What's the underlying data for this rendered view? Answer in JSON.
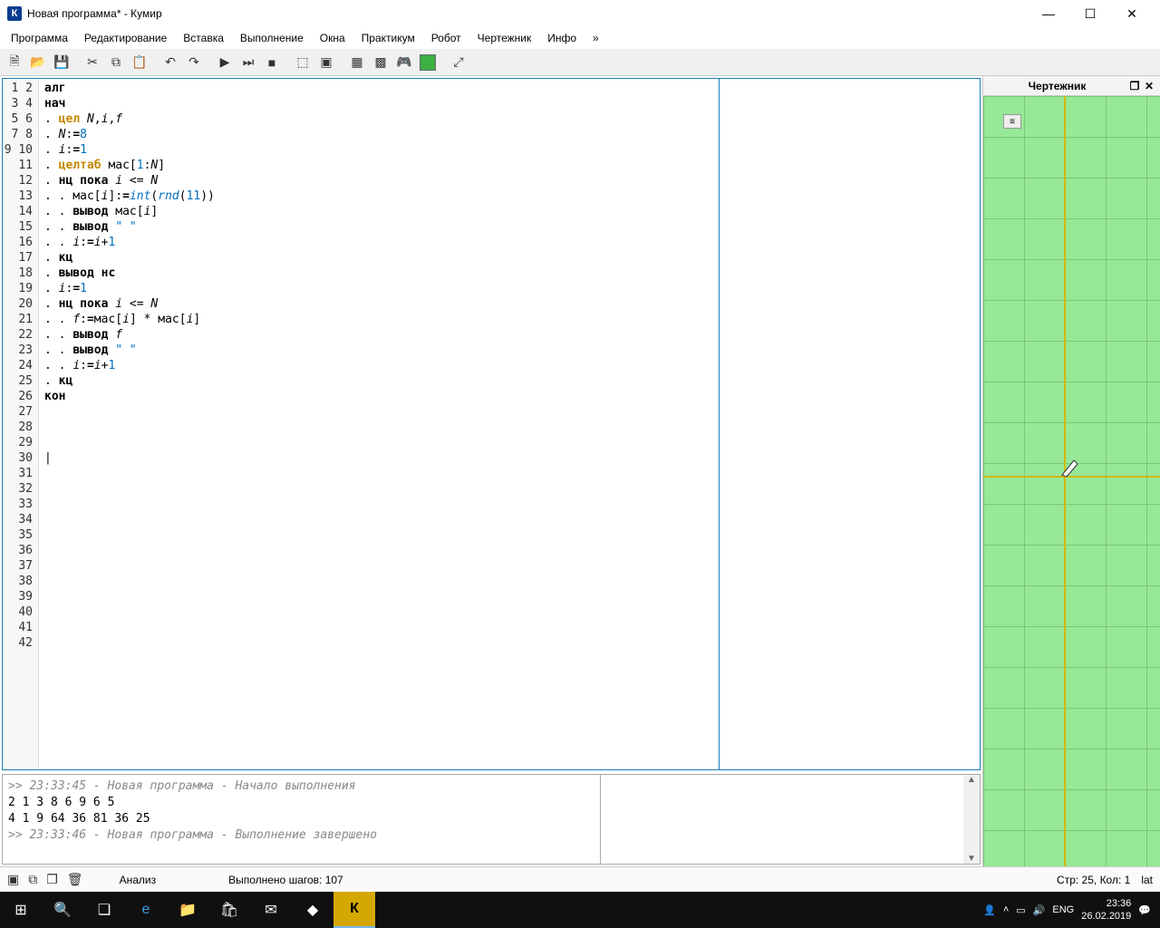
{
  "window": {
    "app_icon": "К",
    "title": "Новая программа* - Кумир"
  },
  "menu": [
    "Программа",
    "Редактирование",
    "Вставка",
    "Выполнение",
    "Окна",
    "Практикум",
    "Робот",
    "Чертежник",
    "Инфо",
    "»"
  ],
  "code": {
    "line_count": 42,
    "cursor_line": 25,
    "lines": [
      [
        {
          "t": "алг",
          "c": "kw"
        }
      ],
      [
        {
          "t": "нач",
          "c": "kw"
        }
      ],
      [
        {
          "t": ". ",
          "c": ""
        },
        {
          "t": "цел",
          "c": "ty"
        },
        {
          "t": " ",
          "c": ""
        },
        {
          "t": "N",
          "c": "var"
        },
        {
          "t": ",",
          "c": ""
        },
        {
          "t": "i",
          "c": "var"
        },
        {
          "t": ",",
          "c": ""
        },
        {
          "t": "f",
          "c": "var"
        }
      ],
      [
        {
          "t": ". ",
          "c": ""
        },
        {
          "t": "N",
          "c": "var"
        },
        {
          "t": ":",
          "c": ""
        },
        {
          "t": "=",
          "c": "kw"
        },
        {
          "t": "8",
          "c": "num"
        }
      ],
      [
        {
          "t": ". ",
          "c": ""
        },
        {
          "t": "i",
          "c": "var"
        },
        {
          "t": ":",
          "c": ""
        },
        {
          "t": "=",
          "c": "kw"
        },
        {
          "t": "1",
          "c": "num"
        }
      ],
      [
        {
          "t": ". ",
          "c": ""
        },
        {
          "t": "целтаб",
          "c": "ty"
        },
        {
          "t": " мас[",
          "c": ""
        },
        {
          "t": "1",
          "c": "num"
        },
        {
          "t": ":",
          "c": ""
        },
        {
          "t": "N",
          "c": "var"
        },
        {
          "t": "]",
          "c": ""
        }
      ],
      [
        {
          "t": ". ",
          "c": ""
        },
        {
          "t": "нц пока",
          "c": "kw"
        },
        {
          "t": " ",
          "c": ""
        },
        {
          "t": "i",
          "c": "var"
        },
        {
          "t": " <= ",
          "c": ""
        },
        {
          "t": "N",
          "c": "var"
        }
      ],
      [
        {
          "t": ". . мас[",
          "c": ""
        },
        {
          "t": "i",
          "c": "var"
        },
        {
          "t": "]:",
          "c": ""
        },
        {
          "t": "=",
          "c": "kw"
        },
        {
          "t": "int",
          "c": "fn"
        },
        {
          "t": "(",
          "c": ""
        },
        {
          "t": "rnd",
          "c": "fn"
        },
        {
          "t": "(",
          "c": ""
        },
        {
          "t": "11",
          "c": "num"
        },
        {
          "t": "))",
          "c": ""
        }
      ],
      [
        {
          "t": ". . ",
          "c": ""
        },
        {
          "t": "вывод",
          "c": "kw"
        },
        {
          "t": " мас[",
          "c": ""
        },
        {
          "t": "i",
          "c": "var"
        },
        {
          "t": "]",
          "c": ""
        }
      ],
      [
        {
          "t": ". . ",
          "c": ""
        },
        {
          "t": "вывод",
          "c": "kw"
        },
        {
          "t": " ",
          "c": ""
        },
        {
          "t": "\" \"",
          "c": "str"
        }
      ],
      [
        {
          "t": ". . ",
          "c": ""
        },
        {
          "t": "i",
          "c": "var"
        },
        {
          "t": ":",
          "c": ""
        },
        {
          "t": "=",
          "c": "kw"
        },
        {
          "t": "i",
          "c": "var"
        },
        {
          "t": "+",
          "c": ""
        },
        {
          "t": "1",
          "c": "num"
        }
      ],
      [
        {
          "t": ". ",
          "c": ""
        },
        {
          "t": "кц",
          "c": "kw"
        }
      ],
      [
        {
          "t": ". ",
          "c": ""
        },
        {
          "t": "вывод нс",
          "c": "kw"
        }
      ],
      [
        {
          "t": ". ",
          "c": ""
        },
        {
          "t": "i",
          "c": "var"
        },
        {
          "t": ":",
          "c": ""
        },
        {
          "t": "=",
          "c": "kw"
        },
        {
          "t": "1",
          "c": "num"
        }
      ],
      [
        {
          "t": ". ",
          "c": ""
        },
        {
          "t": "нц пока",
          "c": "kw"
        },
        {
          "t": " ",
          "c": ""
        },
        {
          "t": "i",
          "c": "var"
        },
        {
          "t": " <= ",
          "c": ""
        },
        {
          "t": "N",
          "c": "var"
        }
      ],
      [
        {
          "t": ". . ",
          "c": ""
        },
        {
          "t": "f",
          "c": "var"
        },
        {
          "t": ":",
          "c": ""
        },
        {
          "t": "=",
          "c": "kw"
        },
        {
          "t": "мас[",
          "c": ""
        },
        {
          "t": "i",
          "c": "var"
        },
        {
          "t": "] * мас[",
          "c": ""
        },
        {
          "t": "i",
          "c": "var"
        },
        {
          "t": "]",
          "c": ""
        }
      ],
      [
        {
          "t": ". . ",
          "c": ""
        },
        {
          "t": "вывод",
          "c": "kw"
        },
        {
          "t": " ",
          "c": ""
        },
        {
          "t": "f",
          "c": "var"
        }
      ],
      [
        {
          "t": ". . ",
          "c": ""
        },
        {
          "t": "вывод",
          "c": "kw"
        },
        {
          "t": " ",
          "c": ""
        },
        {
          "t": "\" \"",
          "c": "str"
        }
      ],
      [
        {
          "t": ". . ",
          "c": ""
        },
        {
          "t": "i",
          "c": "var"
        },
        {
          "t": ":",
          "c": ""
        },
        {
          "t": "=",
          "c": "kw"
        },
        {
          "t": "i",
          "c": "var"
        },
        {
          "t": "+",
          "c": ""
        },
        {
          "t": "1",
          "c": "num"
        }
      ],
      [
        {
          "t": ". ",
          "c": ""
        },
        {
          "t": "кц",
          "c": "kw"
        }
      ],
      [
        {
          "t": "кон",
          "c": "kw"
        }
      ]
    ]
  },
  "output": {
    "log1": ">> 23:33:45 - Новая программа - Начало выполнения",
    "row1": "2 1 3 8 6 9 6 5",
    "row2": "4 1 9 64 36 81 36 25",
    "log2": ">> 23:33:46 - Новая программа - Выполнение завершено"
  },
  "side_panel": {
    "title": "Чертежник"
  },
  "status": {
    "analysis": "Анализ",
    "steps": "Выполнено шагов: 107",
    "cursor": "Стр: 25, Кол: 1",
    "layout": "lat"
  },
  "taskbar": {
    "lang": "ENG",
    "time": "23:36",
    "date": "26.02.2019"
  }
}
